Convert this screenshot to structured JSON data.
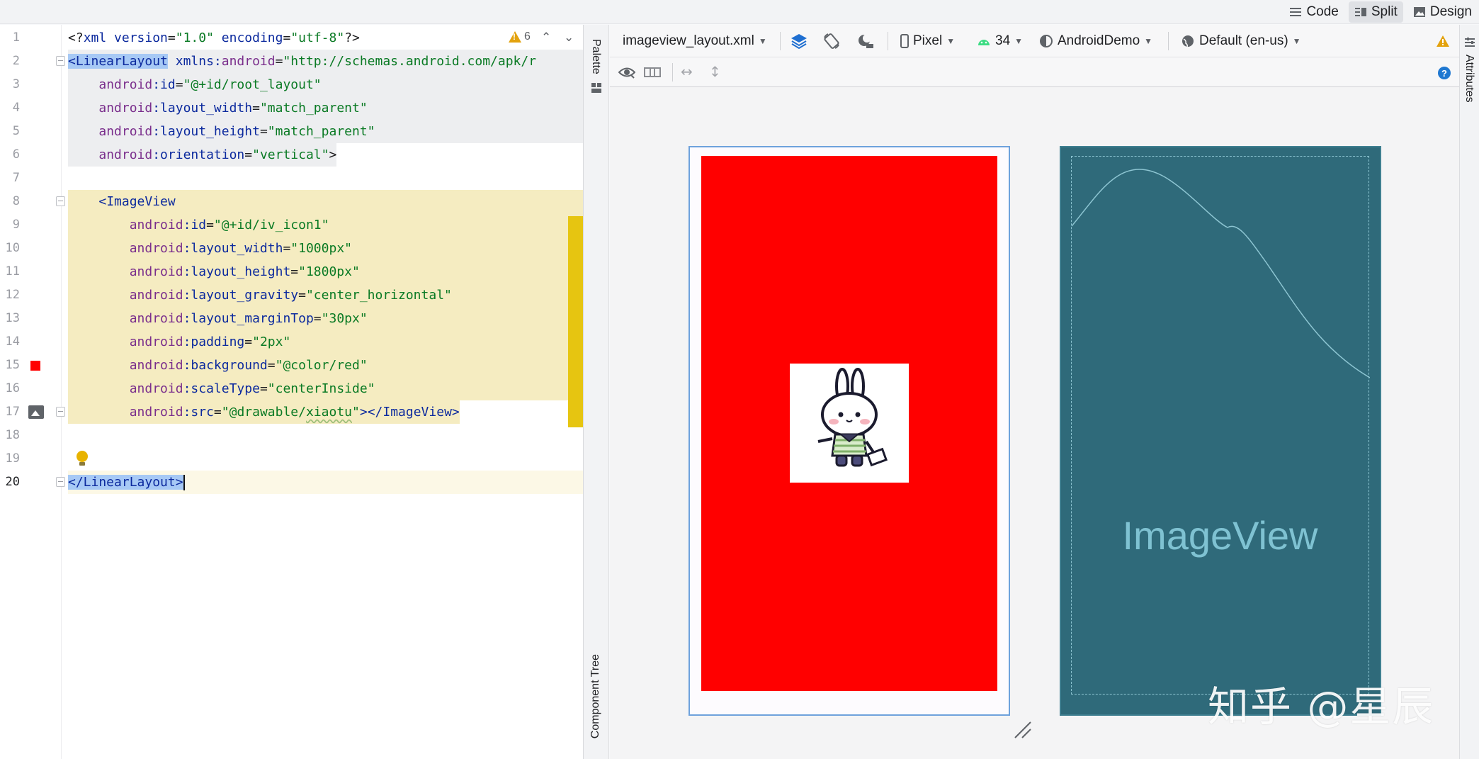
{
  "view_modes": [
    {
      "label": "Code",
      "icon": "lines-icon",
      "active": false
    },
    {
      "label": "Split",
      "icon": "split-icon",
      "active": true
    },
    {
      "label": "Design",
      "icon": "image-icon",
      "active": false
    }
  ],
  "editor": {
    "warnings_count": "6",
    "line_numbers": [
      "1",
      "2",
      "3",
      "4",
      "5",
      "6",
      "7",
      "8",
      "9",
      "10",
      "11",
      "12",
      "13",
      "14",
      "15",
      "16",
      "17",
      "18",
      "19",
      "20"
    ],
    "lines": {
      "l1": {
        "a": "<?",
        "b": "xml version",
        "c": "=",
        "d": "\"1.0\"",
        "e": " encoding",
        "f": "=",
        "g": "\"utf-8\"",
        "h": "?>"
      },
      "l2": {
        "tag": "<LinearLayout",
        "attr": " xmlns:",
        "attr2": "android",
        "eq": "=",
        "val": "\"http://schemas.android.com/apk/r"
      },
      "l3": {
        "ns": "android",
        "attr": ":id",
        "eq": "=",
        "val": "\"@+id/root_layout\""
      },
      "l4": {
        "ns": "android",
        "attr": ":layout_width",
        "eq": "=",
        "val": "\"match_parent\""
      },
      "l5": {
        "ns": "android",
        "attr": ":layout_height",
        "eq": "=",
        "val": "\"match_parent\""
      },
      "l6": {
        "ns": "android",
        "attr": ":orientation",
        "eq": "=",
        "val": "\"vertical\"",
        "end": ">"
      },
      "l8": {
        "tag": "<ImageView"
      },
      "l9": {
        "ns": "android",
        "attr": ":id",
        "eq": "=",
        "val": "\"@+id/iv_icon1\""
      },
      "l10": {
        "ns": "android",
        "attr": ":layout_width",
        "eq": "=",
        "val": "\"1000px\""
      },
      "l11": {
        "ns": "android",
        "attr": ":layout_height",
        "eq": "=",
        "val": "\"1800px\""
      },
      "l12": {
        "ns": "android",
        "attr": ":layout_gravity",
        "eq": "=",
        "val": "\"center_horizontal\""
      },
      "l13": {
        "ns": "android",
        "attr": ":layout_marginTop",
        "eq": "=",
        "val": "\"30px\""
      },
      "l14": {
        "ns": "android",
        "attr": ":padding",
        "eq": "=",
        "val": "\"2px\""
      },
      "l15": {
        "ns": "android",
        "attr": ":background",
        "eq": "=",
        "val": "\"@color/red\""
      },
      "l16": {
        "ns": "android",
        "attr": ":scaleType",
        "eq": "=",
        "val": "\"centerInside\""
      },
      "l17": {
        "ns": "android",
        "attr": ":src",
        "eq": "=",
        "val1": "\"@drawable/",
        "val2": "xiaotu",
        "val3": "\"",
        "end": "></ImageView>"
      },
      "l20": {
        "tag": "</LinearLayout>"
      }
    }
  },
  "side_tabs": {
    "palette": "Palette",
    "component_tree": "Component Tree",
    "attributes": "Attributes"
  },
  "design_toolbar": {
    "file": "imageview_layout.xml",
    "device": "Pixel",
    "api": "34",
    "theme": "AndroidDemo",
    "locale": "Default (en-us)"
  },
  "blueprint": {
    "label": "ImageView"
  },
  "colors": {
    "image_bg": "#ff0000",
    "blueprint_bg": "#2f6a7a",
    "selection": "#a7c9f5",
    "highlight_yellow": "#f5ecc1"
  },
  "watermark": "知乎 @星辰"
}
